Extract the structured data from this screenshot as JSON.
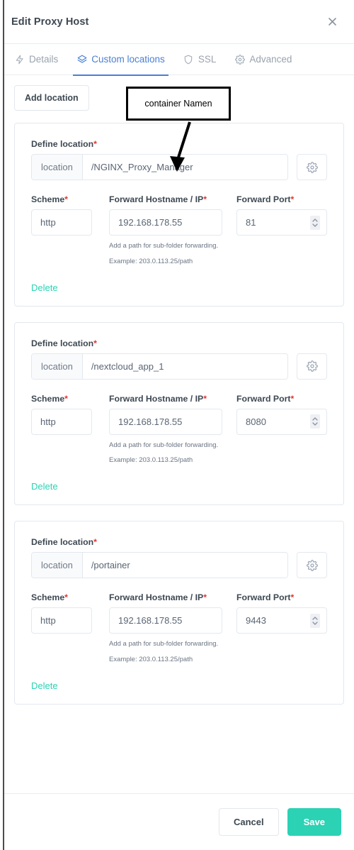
{
  "window": {
    "title": "Edit Proxy Host",
    "close_icon": "close-icon"
  },
  "tabs": [
    {
      "label": "Details",
      "icon": "bolt-icon",
      "active": false
    },
    {
      "label": "Custom locations",
      "icon": "layers-icon",
      "active": true
    },
    {
      "label": "SSL",
      "icon": "shield-icon",
      "active": false
    },
    {
      "label": "Advanced",
      "icon": "gear-icon",
      "active": false
    }
  ],
  "toolbar": {
    "add_location_label": "Add location"
  },
  "annotation": {
    "text": "container Namen"
  },
  "labels": {
    "define_location": "Define location",
    "scheme": "Scheme",
    "forward_hostname": "Forward Hostname / IP",
    "forward_port": "Forward Port",
    "required_mark": "*",
    "location_addon": "location",
    "delete": "Delete",
    "helper_line1": "Add a path for sub-folder forwarding.",
    "helper_line2": "Example: 203.0.113.25/path"
  },
  "locations": [
    {
      "path": "/NGINX_Proxy_Manager",
      "scheme": "http",
      "hostname": "192.168.178.55",
      "port": "81",
      "gear_icon": "gear-icon",
      "spinner_icon": "stepper-icon"
    },
    {
      "path": "/nextcloud_app_1",
      "scheme": "http",
      "hostname": "192.168.178.55",
      "port": "8080",
      "gear_icon": "gear-icon",
      "spinner_icon": "stepper-icon"
    },
    {
      "path": "/portainer",
      "scheme": "http",
      "hostname": "192.168.178.55",
      "port": "9443",
      "gear_icon": "gear-icon",
      "spinner_icon": "stepper-icon"
    }
  ],
  "footer": {
    "cancel_label": "Cancel",
    "save_label": "Save"
  },
  "colors": {
    "accent_blue": "#4a7fd4",
    "accent_teal": "#2bd2b4",
    "required_red": "#e3342f",
    "text_dark": "#3d4852",
    "text_muted": "#9aa3ae",
    "border": "#e3e8ef"
  }
}
